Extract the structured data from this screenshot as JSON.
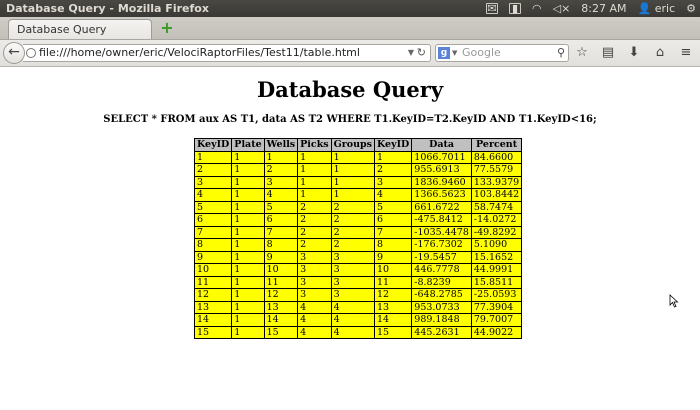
{
  "panel": {
    "window_title": "Database Query - Mozilla Firefox",
    "clock": "8:27 AM",
    "user": "eric"
  },
  "tabs": [
    {
      "label": "Database Query"
    }
  ],
  "navbar": {
    "url": "file:///home/owner/eric/VelociRaptorFiles/Test11/table.html",
    "search_placeholder": "Google"
  },
  "page": {
    "title": "Database Query",
    "query": "SELECT * FROM aux AS T1, data AS T2 WHERE T1.KeyID=T2.KeyID AND T1.KeyID<16;",
    "table": {
      "headers": [
        "KeyID",
        "Plate",
        "Wells",
        "Picks",
        "Groups",
        "KeyID",
        "Data",
        "Percent"
      ],
      "rows": [
        [
          "1",
          "1",
          "1",
          "1",
          "1",
          "1",
          "1066.7011",
          "84.6600"
        ],
        [
          "2",
          "1",
          "2",
          "1",
          "1",
          "2",
          "955.6913",
          "77.5579"
        ],
        [
          "3",
          "1",
          "3",
          "1",
          "1",
          "3",
          "1836.9460",
          "133.9379"
        ],
        [
          "4",
          "1",
          "4",
          "1",
          "1",
          "4",
          "1366.5623",
          "103.8442"
        ],
        [
          "5",
          "1",
          "5",
          "2",
          "2",
          "5",
          "661.6722",
          "58.7474"
        ],
        [
          "6",
          "1",
          "6",
          "2",
          "2",
          "6",
          "-475.8412",
          "-14.0272"
        ],
        [
          "7",
          "1",
          "7",
          "2",
          "2",
          "7",
          "-1035.4478",
          "-49.8292"
        ],
        [
          "8",
          "1",
          "8",
          "2",
          "2",
          "8",
          "-176.7302",
          "5.1090"
        ],
        [
          "9",
          "1",
          "9",
          "3",
          "3",
          "9",
          "-19.5457",
          "15.1652"
        ],
        [
          "10",
          "1",
          "10",
          "3",
          "3",
          "10",
          "446.7778",
          "44.9991"
        ],
        [
          "11",
          "1",
          "11",
          "3",
          "3",
          "11",
          "-8.8239",
          "15.8511"
        ],
        [
          "12",
          "1",
          "12",
          "3",
          "3",
          "12",
          "-648.2785",
          "-25.0593"
        ],
        [
          "13",
          "1",
          "13",
          "4",
          "4",
          "13",
          "953.0733",
          "77.3904"
        ],
        [
          "14",
          "1",
          "14",
          "4",
          "4",
          "14",
          "989.1848",
          "79.7007"
        ],
        [
          "15",
          "1",
          "15",
          "4",
          "4",
          "15",
          "445.2631",
          "44.9022"
        ]
      ]
    }
  }
}
